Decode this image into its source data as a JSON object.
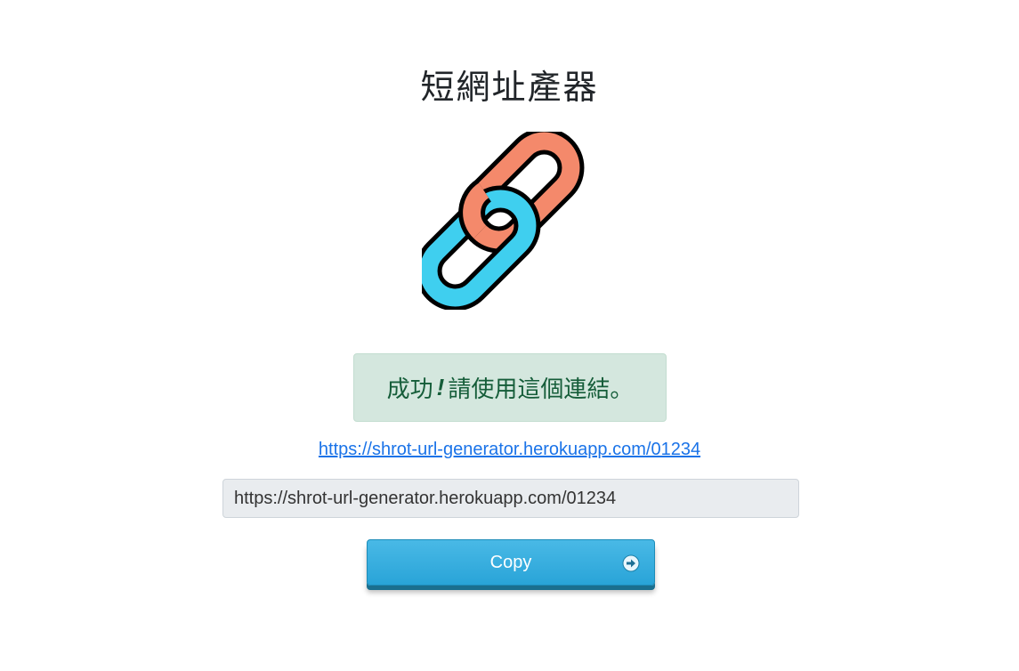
{
  "header": {
    "title": "短網址產器"
  },
  "logo": {
    "icon": "chain-link-icon",
    "colors": {
      "front_link": "#3fcfef",
      "back_link": "#f4896b",
      "outline": "#000000"
    }
  },
  "alert": {
    "success_word": "成功",
    "exclamation": "!",
    "message": "請使用這個連結。"
  },
  "result": {
    "short_url_link": "https://shrot-url-generator.herokuapp.com/01234",
    "short_url_value": "https://shrot-url-generator.herokuapp.com/01234"
  },
  "actions": {
    "copy_label": "Copy",
    "copy_icon": "arrow-right-circle-icon"
  }
}
